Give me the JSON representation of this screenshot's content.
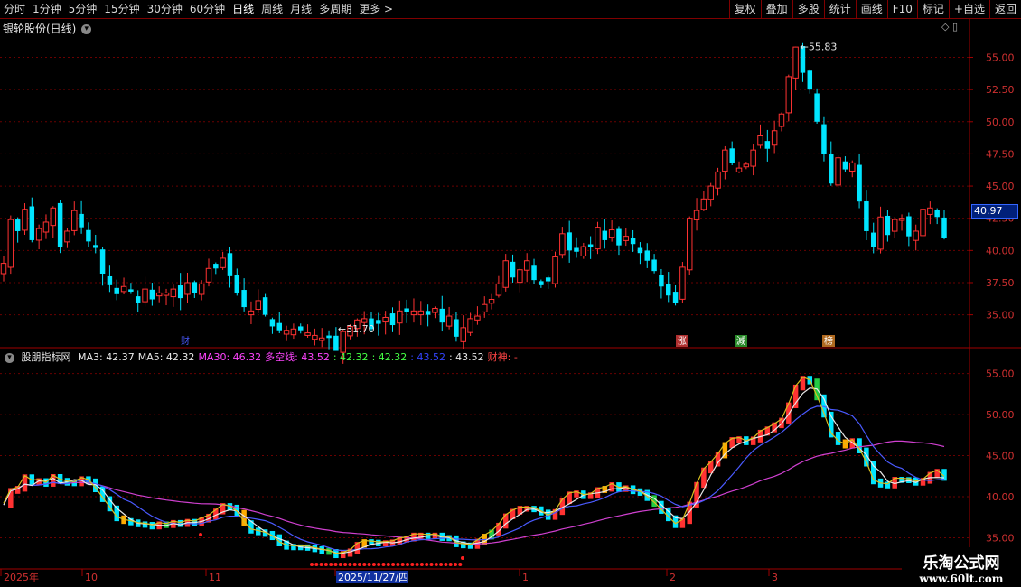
{
  "toolbar": {
    "left": [
      "分时",
      "1分钟",
      "5分钟",
      "15分钟",
      "30分钟",
      "60分钟",
      "日线",
      "周线",
      "月线",
      "多周期",
      "更多 >"
    ],
    "active": "日线",
    "right": [
      "复权",
      "叠加",
      "多股",
      "统计",
      "画线",
      "F10",
      "标记",
      "+自选",
      "返回"
    ]
  },
  "main": {
    "title": "银轮股份(日线)",
    "current_price": "40.97",
    "high_label": "55.83",
    "low_label": "31.70",
    "y_ticks": [
      "55.00",
      "52.50",
      "50.00",
      "47.50",
      "45.00",
      "42.50",
      "40.00",
      "37.50",
      "35.00"
    ],
    "markers": [
      {
        "text": "财",
        "color": "#4a5aff",
        "bg": "#000000"
      },
      {
        "text": "涨",
        "color": "#ffffff",
        "bg": "#b03030"
      },
      {
        "text": "減",
        "color": "#ffffff",
        "bg": "#2a8a2a"
      },
      {
        "text": "榜",
        "color": "#ffffff",
        "bg": "#b06a20"
      }
    ]
  },
  "indicator": {
    "name": "股朋指标网",
    "items": [
      {
        "text": "MA3: 42.37",
        "color": "#e8e8e8"
      },
      {
        "text": "MA5: 42.32",
        "color": "#e8e8e8"
      },
      {
        "text": "MA30: 46.32",
        "color": "#ff44ff"
      },
      {
        "text": "多空线: 43.52",
        "color": "#ff44ff"
      },
      {
        "text": ": 42.32",
        "color": "#44ff44"
      },
      {
        "text": ": 42.32",
        "color": "#44ff44"
      },
      {
        "text": ": 43.52",
        "color": "#3344ff"
      },
      {
        "text": ": 43.52",
        "color": "#e8e8e8"
      },
      {
        "text": "财神: -",
        "color": "#ff4444"
      }
    ],
    "y_ticks": [
      "55.00",
      "50.00",
      "45.00",
      "40.00",
      "35.00"
    ]
  },
  "xaxis": {
    "labels": [
      "2025年",
      "10",
      "11",
      "2025/11/27/四",
      "1",
      "2",
      "3"
    ]
  },
  "watermark": {
    "line1": "乐淘公式网",
    "line2": "www.60lt.com"
  },
  "chart_data": {
    "type": "candlestick",
    "closes": [
      39.0,
      42.4,
      41.5,
      43.2,
      40.8,
      41.7,
      42.2,
      43.3,
      40.3,
      41.5,
      43.1,
      41.8,
      40.7,
      40.2,
      38.2,
      37.3,
      36.6,
      37.2,
      36.8,
      35.9,
      37.0,
      36.2,
      36.7,
      36.7,
      37.0,
      36.3,
      37.5,
      36.7,
      37.4,
      38.6,
      38.6,
      39.4,
      38.0,
      36.7,
      35.6,
      35.3,
      36.1,
      35.0,
      34.1,
      33.8,
      33.8,
      33.9,
      33.8,
      33.6,
      33.4,
      33.2,
      33.2,
      32.2,
      33.7,
      34.1,
      34.6,
      34.7,
      33.9,
      34.3,
      34.8,
      34.2,
      35.3,
      35.2,
      35.3,
      35.3,
      35.0,
      35.5,
      34.4,
      34.9,
      33.3,
      34.0,
      34.7,
      34.9,
      35.8,
      36.2,
      37.4,
      39.2,
      37.9,
      38.5,
      39.2,
      37.7,
      37.3,
      37.6,
      39.5,
      41.3,
      40.0,
      39.9,
      40.3,
      40.3,
      41.8,
      40.8,
      41.6,
      40.4,
      41.1,
      40.5,
      39.8,
      39.2,
      38.4,
      37.2,
      36.5,
      35.9,
      38.7,
      42.5,
      43.1,
      44.0,
      45.0,
      46.1,
      47.8,
      46.8,
      46.4,
      46.7,
      47.8,
      48.9,
      47.9,
      49.3,
      50.6,
      53.5,
      55.8,
      53.8,
      52.5,
      50.0,
      47.5,
      45.2,
      47.2,
      46.3,
      46.8,
      43.8,
      41.5,
      40.3,
      42.6,
      41.2,
      42.4,
      42.5,
      41.1,
      41.5,
      43.2,
      43.3,
      42.6,
      40.97
    ],
    "high": "55.83",
    "low": "31.70",
    "ylim": [
      33.5,
      57.0
    ],
    "ma30": [
      42.0,
      42.1,
      42.1,
      42.1,
      41.9,
      41.8,
      41.6,
      41.3,
      41.0,
      40.6,
      40.3,
      40.0,
      39.7,
      39.4,
      39.1,
      38.9,
      38.7,
      38.5,
      38.3,
      38.1,
      37.9,
      37.8,
      37.7,
      37.6,
      37.5,
      37.3,
      37.1,
      36.9,
      36.7,
      36.5,
      36.3,
      36.0,
      35.8,
      35.6,
      35.4,
      35.2,
      35.0,
      34.8,
      34.7,
      34.6,
      34.6,
      34.5,
      34.5,
      34.4,
      34.4,
      34.4,
      34.4,
      34.4,
      34.5,
      34.6,
      34.7,
      34.8,
      35.0,
      35.2,
      35.4,
      35.6,
      35.8,
      36.0,
      36.3,
      36.6,
      36.9,
      37.2,
      37.5,
      37.8,
      38.1,
      38.4,
      38.7,
      39.0,
      39.3,
      39.6,
      39.9,
      40.2,
      40.6,
      41.0,
      41.4,
      41.8,
      42.2,
      42.7,
      43.3,
      43.9,
      44.5,
      45.1,
      45.7,
      46.3,
      46.9,
      47.5,
      48.0,
      48.6,
      49.1,
      49.4,
      49.5,
      49.4,
      49.2,
      48.9,
      48.5,
      48.1,
      47.6,
      47.1,
      46.6,
      46.3,
      46.32
    ]
  }
}
